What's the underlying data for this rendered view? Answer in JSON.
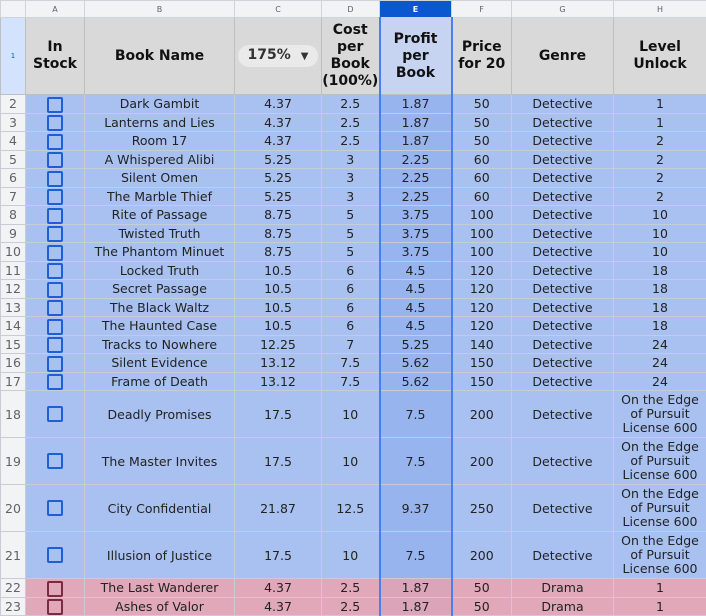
{
  "columns": [
    "A",
    "B",
    "C",
    "D",
    "E",
    "F",
    "G",
    "H"
  ],
  "selected_column": "E",
  "header": {
    "in_stock": "In Stock",
    "book_name": "Book Name",
    "percent_value": "175%",
    "cost_per_book": "Cost per Book (100%)",
    "profit_per_book": "Profit per Book",
    "price_for_20": "Price for 20",
    "genre": "Genre",
    "level_unlock": "Level Unlock"
  },
  "icons": {
    "dropdown": "chevron-down-icon",
    "checkbox": "checkbox-icon"
  },
  "colors": {
    "detective_row": "#a8c1f0",
    "drama_row": "#e0a8b8",
    "selected_column": "#0b57d0"
  },
  "rows": [
    {
      "num": "2",
      "name": "Dark Gambit",
      "c": "4.37",
      "d": "2.5",
      "e": "1.87",
      "f": "50",
      "genre": "Detective",
      "level": "1",
      "checked": false
    },
    {
      "num": "3",
      "name": "Lanterns and Lies",
      "c": "4.37",
      "d": "2.5",
      "e": "1.87",
      "f": "50",
      "genre": "Detective",
      "level": "1",
      "checked": false
    },
    {
      "num": "4",
      "name": "Room 17",
      "c": "4.37",
      "d": "2.5",
      "e": "1.87",
      "f": "50",
      "genre": "Detective",
      "level": "2",
      "checked": false
    },
    {
      "num": "5",
      "name": "A Whispered Alibi",
      "c": "5.25",
      "d": "3",
      "e": "2.25",
      "f": "60",
      "genre": "Detective",
      "level": "2",
      "checked": false
    },
    {
      "num": "6",
      "name": "Silent Omen",
      "c": "5.25",
      "d": "3",
      "e": "2.25",
      "f": "60",
      "genre": "Detective",
      "level": "2",
      "checked": false
    },
    {
      "num": "7",
      "name": "The Marble Thief",
      "c": "5.25",
      "d": "3",
      "e": "2.25",
      "f": "60",
      "genre": "Detective",
      "level": "2",
      "checked": false
    },
    {
      "num": "8",
      "name": "Rite of Passage",
      "c": "8.75",
      "d": "5",
      "e": "3.75",
      "f": "100",
      "genre": "Detective",
      "level": "10",
      "checked": false
    },
    {
      "num": "9",
      "name": "Twisted Truth",
      "c": "8.75",
      "d": "5",
      "e": "3.75",
      "f": "100",
      "genre": "Detective",
      "level": "10",
      "checked": false
    },
    {
      "num": "10",
      "name": "The Phantom Minuet",
      "c": "8.75",
      "d": "5",
      "e": "3.75",
      "f": "100",
      "genre": "Detective",
      "level": "10",
      "checked": false
    },
    {
      "num": "11",
      "name": "Locked Truth",
      "c": "10.5",
      "d": "6",
      "e": "4.5",
      "f": "120",
      "genre": "Detective",
      "level": "18",
      "checked": false
    },
    {
      "num": "12",
      "name": "Secret Passage",
      "c": "10.5",
      "d": "6",
      "e": "4.5",
      "f": "120",
      "genre": "Detective",
      "level": "18",
      "checked": false
    },
    {
      "num": "13",
      "name": "The Black Waltz",
      "c": "10.5",
      "d": "6",
      "e": "4.5",
      "f": "120",
      "genre": "Detective",
      "level": "18",
      "checked": false
    },
    {
      "num": "14",
      "name": "The Haunted Case",
      "c": "10.5",
      "d": "6",
      "e": "4.5",
      "f": "120",
      "genre": "Detective",
      "level": "18",
      "checked": false
    },
    {
      "num": "15",
      "name": "Tracks to Nowhere",
      "c": "12.25",
      "d": "7",
      "e": "5.25",
      "f": "140",
      "genre": "Detective",
      "level": "24",
      "checked": false
    },
    {
      "num": "16",
      "name": "Silent Evidence",
      "c": "13.12",
      "d": "7.5",
      "e": "5.62",
      "f": "150",
      "genre": "Detective",
      "level": "24",
      "checked": false
    },
    {
      "num": "17",
      "name": "Frame of Death",
      "c": "13.12",
      "d": "7.5",
      "e": "5.62",
      "f": "150",
      "genre": "Detective",
      "level": "24",
      "checked": false
    },
    {
      "num": "18",
      "name": "Deadly Promises",
      "c": "17.5",
      "d": "10",
      "e": "7.5",
      "f": "200",
      "genre": "Detective",
      "level": "On the Edge of Pursuit License 600",
      "checked": false
    },
    {
      "num": "19",
      "name": "The Master Invites",
      "c": "17.5",
      "d": "10",
      "e": "7.5",
      "f": "200",
      "genre": "Detective",
      "level": "On the Edge of Pursuit License 600",
      "checked": false
    },
    {
      "num": "20",
      "name": "City Confidential",
      "c": "21.87",
      "d": "12.5",
      "e": "9.37",
      "f": "250",
      "genre": "Detective",
      "level": "On the Edge of Pursuit License 600",
      "checked": false
    },
    {
      "num": "21",
      "name": "Illusion of Justice",
      "c": "17.5",
      "d": "10",
      "e": "7.5",
      "f": "200",
      "genre": "Detective",
      "level": "On the Edge of Pursuit License 600",
      "checked": false
    },
    {
      "num": "22",
      "name": "The Last Wanderer",
      "c": "4.37",
      "d": "2.5",
      "e": "1.87",
      "f": "50",
      "genre": "Drama",
      "level": "1",
      "checked": false
    },
    {
      "num": "23",
      "name": "Ashes of Valor",
      "c": "4.37",
      "d": "2.5",
      "e": "1.87",
      "f": "50",
      "genre": "Drama",
      "level": "1",
      "checked": false
    }
  ]
}
